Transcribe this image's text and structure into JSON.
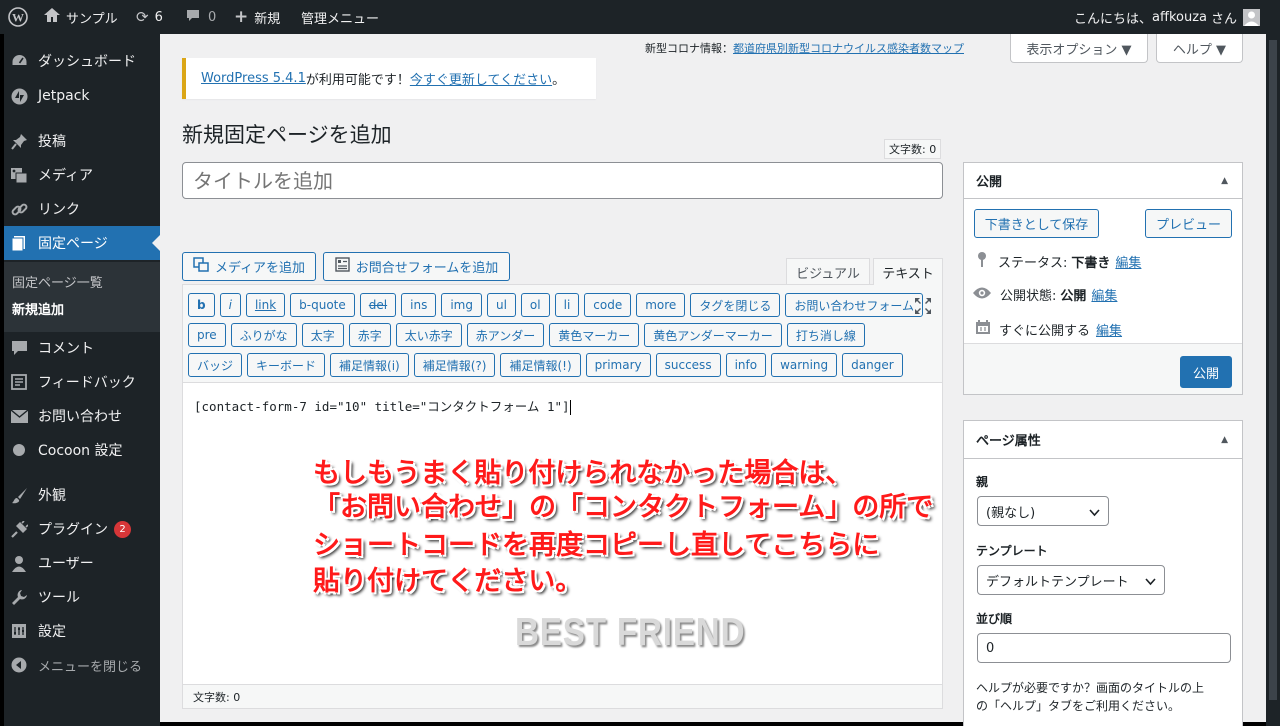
{
  "adminbar": {
    "site_name": "サンプル",
    "updates": "6",
    "comments": "0",
    "new_label": "新規",
    "admin_menu": "管理メニュー",
    "greeting": "こんにちは、",
    "user": "affkouza",
    "san": "さん"
  },
  "sidebar": {
    "items": [
      {
        "label": "ダッシュボード",
        "icon": "dashboard-icon"
      },
      {
        "label": "Jetpack",
        "icon": "jetpack-icon"
      },
      {
        "label": "投稿",
        "icon": "pin-icon"
      },
      {
        "label": "メディア",
        "icon": "media-icon"
      },
      {
        "label": "リンク",
        "icon": "link-icon"
      },
      {
        "label": "固定ページ",
        "icon": "page-icon"
      },
      {
        "label": "コメント",
        "icon": "comment-icon"
      },
      {
        "label": "フィードバック",
        "icon": "feedback-icon"
      },
      {
        "label": "お問い合わせ",
        "icon": "mail-icon"
      },
      {
        "label": "Cocoon 設定",
        "icon": "circle-icon"
      },
      {
        "label": "外観",
        "icon": "brush-icon"
      },
      {
        "label": "プラグイン",
        "icon": "plugin-icon",
        "badge": "2"
      },
      {
        "label": "ユーザー",
        "icon": "user-icon"
      },
      {
        "label": "ツール",
        "icon": "wrench-icon"
      },
      {
        "label": "設定",
        "icon": "settings-icon"
      },
      {
        "label": "メニューを閉じる",
        "icon": "collapse-icon"
      }
    ],
    "sub": [
      "固定ページ一覧",
      "新規追加"
    ]
  },
  "topnotice": {
    "prefix": "新型コロナ情報：",
    "link": "都道府県別新型コロナウイルス感染者数マップ"
  },
  "screen_options": "表示オプション ▼",
  "help": "ヘルプ ▼",
  "notice": {
    "link1": "WordPress 5.4.1",
    "text": " が利用可能です！",
    "link2": "今すぐ更新してください",
    "end": "。"
  },
  "page_title": "新規固定ページを追加",
  "char_count_top": "文字数: 0",
  "title_placeholder": "タイトルを追加",
  "media_button": "メディアを追加",
  "form_button": "お問合せフォームを追加",
  "tabs": {
    "visual": "ビジュアル",
    "text": "テキスト"
  },
  "quicktags": {
    "row1": [
      "b",
      "i",
      "link",
      "b-quote",
      "del",
      "ins",
      "img",
      "ul",
      "ol",
      "li",
      "code",
      "more",
      "タグを閉じる",
      "お問い合わせフォーム"
    ],
    "row2": [
      "pre",
      "ふりがな",
      "太字",
      "赤字",
      "太い赤字",
      "赤アンダー",
      "黄色マーカー",
      "黄色アンダーマーカー",
      "打ち消し線"
    ],
    "row3": [
      "バッジ",
      "キーボード",
      "補足情報(i)",
      "補足情報(?)",
      "補足情報(!)",
      "primary",
      "success",
      "info",
      "warning",
      "danger"
    ]
  },
  "editor_content": "[contact-form-7 id=\"10\" title=\"コンタクトフォーム 1\"]",
  "overlay_lines": [
    "もしもうまく貼り付けられなかった場合は、",
    "「お問い合わせ」の「コンタクトフォーム」の所で",
    "ショートコードを再度コピーし直してこちらに",
    "貼り付けてください。"
  ],
  "watermark": "BEST FRIEND",
  "char_count_bottom": "文字数: 0",
  "publish": {
    "title": "公開",
    "save_draft": "下書きとして保存",
    "preview": "プレビュー",
    "status_label": "ステータス:",
    "status_value": "下書き",
    "visibility_label": "公開状態:",
    "visibility_value": "公開",
    "schedule": "すぐに公開する",
    "edit": "編集",
    "publish_button": "公開"
  },
  "attrs": {
    "title": "ページ属性",
    "parent_label": "親",
    "parent_value": "(親なし)",
    "template_label": "テンプレート",
    "template_value": "デフォルトテンプレート",
    "order_label": "並び順",
    "order_value": "0",
    "help_text1": "ヘルプが必要ですか？画面のタイトルの上",
    "help_text2": "の「ヘルプ」タブをご利用ください。"
  },
  "colors": {
    "accent": "#2271b1",
    "adminbar": "#1d2327",
    "overlay_red": "#ff1a1a"
  }
}
